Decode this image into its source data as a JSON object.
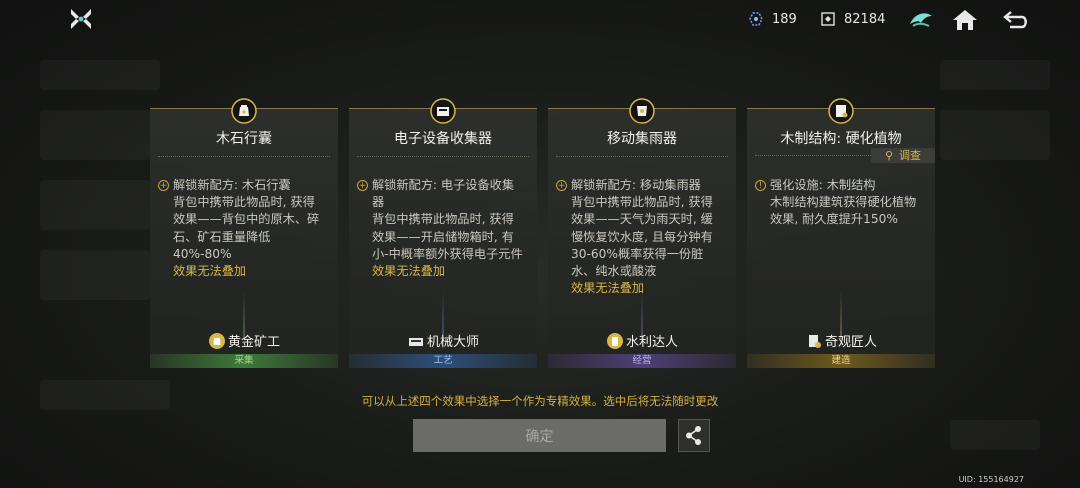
{
  "topbar": {
    "resources": [
      {
        "icon": "crystal-icon",
        "value": "189"
      },
      {
        "icon": "scrap-icon",
        "value": "82184"
      }
    ]
  },
  "cards": [
    {
      "title": "木石行囊",
      "medal_icon": "pouch-medal-icon",
      "desc_first": "解锁新配方: 木石行囊",
      "desc_rest": "背包中携带此物品时, 获得效果——背包中的原木、碎石、矿石重量降低40%-80%",
      "warn": "效果无法叠加",
      "tag": "黄金矿工",
      "category": "采集",
      "category_color": "#3f7a3a"
    },
    {
      "title": "电子设备收集器",
      "medal_icon": "device-medal-icon",
      "desc_first": "解锁新配方: 电子设备收集器",
      "desc_rest": "背包中携带此物品时, 获得效果——开启储物箱时, 有小-中概率额外获得电子元件",
      "warn": "效果无法叠加",
      "tag": "机械大师",
      "category": "工艺",
      "category_color": "#2d4f7a"
    },
    {
      "title": "移动集雨器",
      "medal_icon": "rain-medal-icon",
      "desc_first": "解锁新配方: 移动集雨器",
      "desc_rest": "背包中携带此物品时, 获得效果——天气为雨天时, 缓慢恢复饮水度, 且每分钟有30-60%概率获得一份脏水、纯水或酸液",
      "warn": "效果无法叠加",
      "tag": "水利达人",
      "category": "经营",
      "category_color": "#4f3f78"
    },
    {
      "title": "木制结构: 硬化植物",
      "medal_icon": "structure-medal-icon",
      "desc_first": "强化设施: 木制结构",
      "desc_rest": "木制结构建筑获得硬化植物效果, 耐久度提升150%",
      "warn": "",
      "tag": "奇观匠人",
      "category": "建造",
      "category_color": "#6e5a1e",
      "investigate": "调查"
    }
  ],
  "hint": "可以从上述四个效果中选择一个作为专精效果。选中后将无法随时更改",
  "confirm_label": "确定",
  "uid": "UID: 155164927",
  "colors": {
    "accent": "#d8b64a",
    "confirm_bg": "#6b6b68"
  }
}
